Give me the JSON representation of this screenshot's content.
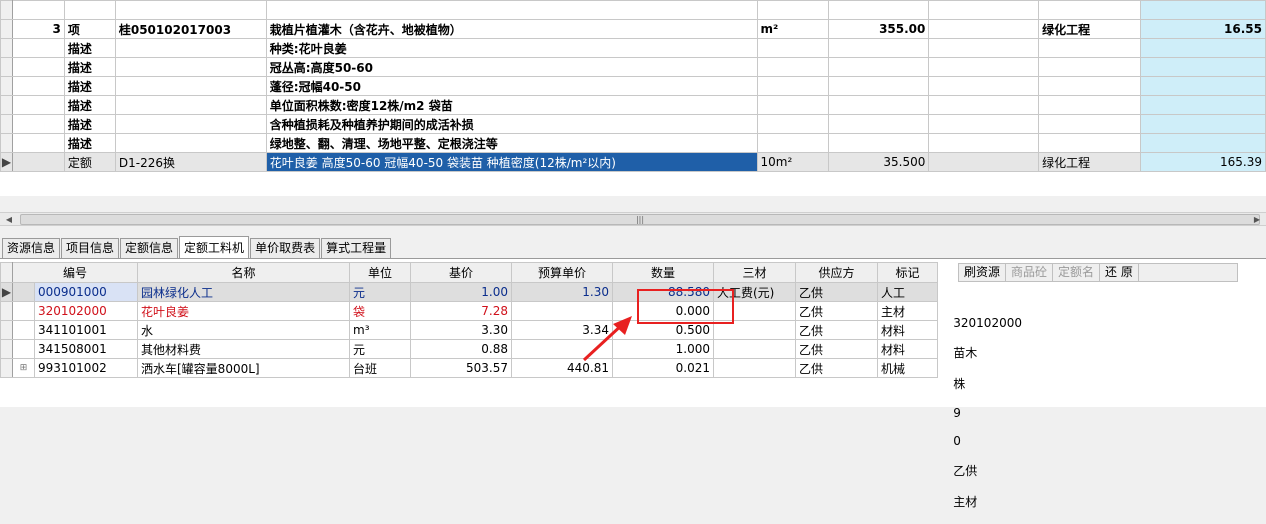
{
  "top_grid": {
    "rows": [
      {
        "c_seq": "",
        "c_type": "",
        "c_code": "",
        "c_name": "",
        "c_unit": "",
        "c_qty": "",
        "c_empty": "",
        "c_cat": "",
        "c_price": ""
      },
      {
        "c_seq": "3",
        "c_type": "项",
        "c_code": "桂050102017003",
        "c_name": "栽植片植灌木（含花卉、地被植物）",
        "c_unit": "m²",
        "c_qty": "355.00",
        "c_empty": "",
        "c_cat": "绿化工程",
        "c_price": "16.55"
      },
      {
        "c_seq": "",
        "c_type": "描述",
        "c_code": "",
        "c_name": "种类:花叶良姜",
        "c_unit": "",
        "c_qty": "",
        "c_empty": "",
        "c_cat": "",
        "c_price": ""
      },
      {
        "c_seq": "",
        "c_type": "描述",
        "c_code": "",
        "c_name": "冠丛高:高度50-60",
        "c_unit": "",
        "c_qty": "",
        "c_empty": "",
        "c_cat": "",
        "c_price": ""
      },
      {
        "c_seq": "",
        "c_type": "描述",
        "c_code": "",
        "c_name": "蓬径:冠幅40-50",
        "c_unit": "",
        "c_qty": "",
        "c_empty": "",
        "c_cat": "",
        "c_price": ""
      },
      {
        "c_seq": "",
        "c_type": "描述",
        "c_code": "",
        "c_name": "单位面积株数:密度12株/m2 袋苗",
        "c_unit": "",
        "c_qty": "",
        "c_empty": "",
        "c_cat": "",
        "c_price": ""
      },
      {
        "c_seq": "",
        "c_type": "描述",
        "c_code": "",
        "c_name": "含种植损耗及种植养护期间的成活补损",
        "c_unit": "",
        "c_qty": "",
        "c_empty": "",
        "c_cat": "",
        "c_price": ""
      },
      {
        "c_seq": "",
        "c_type": "描述",
        "c_code": "",
        "c_name": "绿地整、翻、清理、场地平整、定根浇注等",
        "c_unit": "",
        "c_qty": "",
        "c_empty": "",
        "c_cat": "",
        "c_price": ""
      },
      {
        "c_seq": "",
        "c_type": "定额",
        "c_code": "D1-226换",
        "c_name": "花叶良姜 高度50-60 冠幅40-50 袋装苗 种植密度(12株/m²以内)",
        "c_unit": "10m²",
        "c_qty": "35.500",
        "c_empty": "",
        "c_cat": "绿化工程",
        "c_price": "165.39"
      }
    ]
  },
  "tabs": [
    "资源信息",
    "项目信息",
    "定额信息",
    "定额工料机",
    "单价取费表",
    "算式工程量"
  ],
  "bottom_grid": {
    "headers": [
      "编号",
      "名称",
      "单位",
      "基价",
      "预算单价",
      "数量",
      "三材",
      "供应方",
      "标记"
    ],
    "rows": [
      {
        "code": "000901000",
        "name": "园林绿化人工",
        "unit": "元",
        "base": "1.00",
        "budget": "1.30",
        "qty": "88.580",
        "three": "人工费(元)",
        "supplier": "乙供",
        "mark": "人工"
      },
      {
        "code": "320102000",
        "name": "花叶良姜",
        "unit": "袋",
        "base": "7.28",
        "budget": "",
        "qty": "0.000",
        "three": "",
        "supplier": "乙供",
        "mark": "主材"
      },
      {
        "code": "341101001",
        "name": "水",
        "unit": "m³",
        "base": "3.30",
        "budget": "3.34",
        "qty": "0.500",
        "three": "",
        "supplier": "乙供",
        "mark": "材料"
      },
      {
        "code": "341508001",
        "name": "其他材料费",
        "unit": "元",
        "base": "0.88",
        "budget": "",
        "qty": "1.000",
        "three": "",
        "supplier": "乙供",
        "mark": "材料"
      },
      {
        "code": "993101002",
        "name": "洒水车[罐容量8000L]",
        "unit": "台班",
        "base": "503.57",
        "budget": "440.81",
        "qty": "0.021",
        "three": "",
        "supplier": "乙供",
        "mark": "机械"
      }
    ]
  },
  "side_panel": {
    "buttons": [
      "刷资源",
      "商品砼",
      "定额名",
      "还 原"
    ],
    "row": {
      "code": "320102000",
      "name": "苗木",
      "unit": "株",
      "v1": "9",
      "v2": "0",
      "supplier": "乙供",
      "mark": "主材"
    }
  },
  "colors": {
    "selection": "#1f5fa8",
    "highlight_col": "#cfeef9",
    "annotation": "#e82020"
  }
}
